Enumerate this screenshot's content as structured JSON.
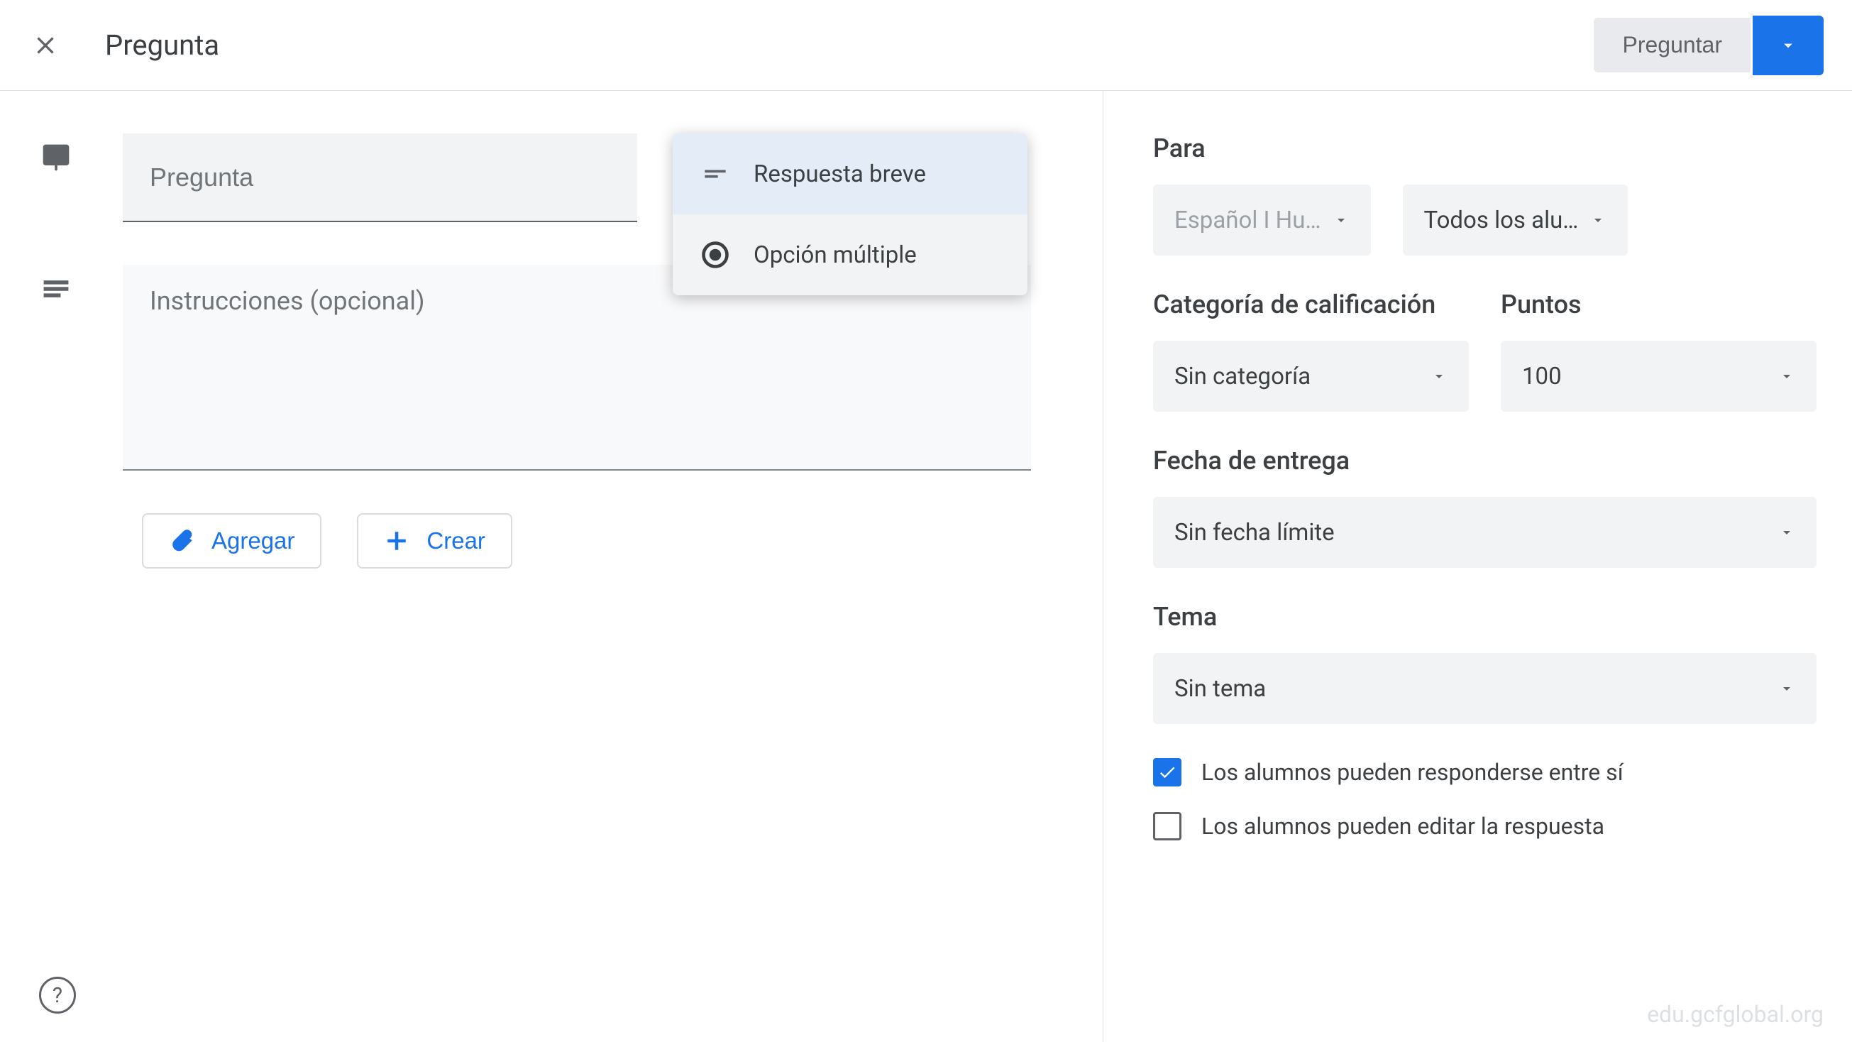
{
  "header": {
    "title": "Pregunta",
    "ask_label": "Preguntar"
  },
  "question": {
    "placeholder": "Pregunta",
    "instructions_placeholder": "Instrucciones (opcional)",
    "type_options": {
      "short": "Respuesta breve",
      "multiple": "Opción múltiple"
    }
  },
  "attach": {
    "add": "Agregar",
    "create": "Crear"
  },
  "sidebar": {
    "for_label": "Para",
    "class_sel": "Español I Hu…",
    "students_sel": "Todos los alu…",
    "grade_cat_label": "Categoría de calificación",
    "grade_cat_sel": "Sin categoría",
    "points_label": "Puntos",
    "points_sel": "100",
    "due_label": "Fecha de entrega",
    "due_sel": "Sin fecha límite",
    "topic_label": "Tema",
    "topic_sel": "Sin tema",
    "opt_reply": "Los alumnos pueden responderse entre sí",
    "opt_edit": "Los alumnos pueden editar la respuesta"
  },
  "watermark": "edu.gcfglobal.org"
}
